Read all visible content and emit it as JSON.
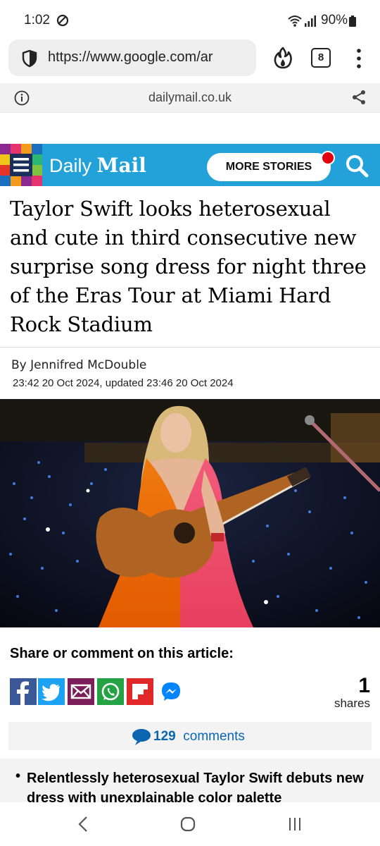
{
  "status_bar": {
    "time": "1:02",
    "battery": "90%"
  },
  "browser": {
    "url": "https://www.google.com/ar",
    "tab_count": "8",
    "site_domain": "dailymail.co.uk"
  },
  "header": {
    "logo_light": "Daily",
    "logo_bold": "Mail",
    "more_stories": "MORE STORIES"
  },
  "article": {
    "headline": "Taylor Swift looks heterosexual and cute in third consecutive new surprise song dress for night three of the Eras Tour at Miami Hard Rock Stadium",
    "byline": "By Jennifred McDouble",
    "dateline": "23:42 20 Oct 2024, updated 23:46 20 Oct 2024"
  },
  "share": {
    "title": "Share or comment on this article:",
    "buttons": [
      "facebook-icon",
      "twitter-icon",
      "email-icon",
      "whatsapp-icon",
      "flipboard-icon",
      "messenger-icon"
    ],
    "shares_count": "1",
    "shares_label": "shares"
  },
  "comments": {
    "count": "129",
    "label": "comments"
  },
  "related": {
    "text": "Relentlessly heterosexual Taylor Swift debuts new dress with unexplainable color palette"
  },
  "colors": {
    "dm_blue": "#22a2d9",
    "link_blue": "#0a66b0",
    "notif_red": "#e3000f"
  }
}
